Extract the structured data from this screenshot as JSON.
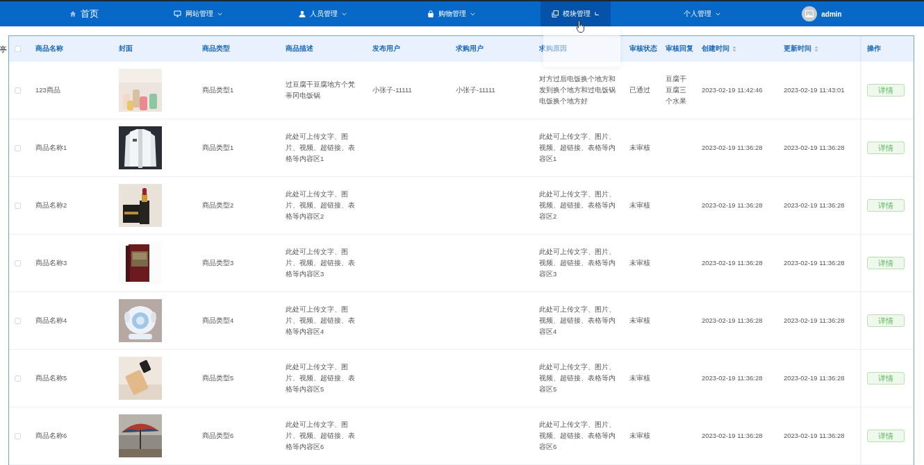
{
  "nav": {
    "items": [
      {
        "label": "首页",
        "kind": "link",
        "selected": false
      },
      {
        "label": "网站管理",
        "kind": "menu",
        "selected": false,
        "expanded": false
      },
      {
        "label": "人员管理",
        "kind": "menu",
        "selected": false,
        "expanded": false
      },
      {
        "label": "购物管理",
        "kind": "menu",
        "selected": false,
        "expanded": false
      },
      {
        "label": "模块管理",
        "kind": "menu",
        "selected": true,
        "expanded": true
      },
      {
        "label": "个人管理",
        "kind": "menu",
        "selected": false,
        "expanded": false
      }
    ],
    "user": {
      "name": "admin"
    }
  },
  "stray_text": "亭",
  "table": {
    "header_checked": false,
    "columns": [
      {
        "label": "商品名称"
      },
      {
        "label": "封面"
      },
      {
        "label": "商品类型"
      },
      {
        "label": "商品描述"
      },
      {
        "label": "发布用户"
      },
      {
        "label": "求购用户"
      },
      {
        "label": "求购原因"
      },
      {
        "label": "审核状态"
      },
      {
        "label": "审核回复"
      },
      {
        "label": "创建时间",
        "sortable": true
      },
      {
        "label": "更新时间",
        "sortable": true
      },
      {
        "label": "操作"
      }
    ],
    "rows": [
      {
        "checked": false,
        "name": "123商品",
        "type": "商品类型1",
        "description": "过豆腐干豆腐地方个梵蒂冈电饭锅",
        "publisher": "小张子-11111",
        "buyer": "小张子-11111",
        "reason": "对方过后电饭换个地方和发到换个地方和过电饭锅电饭换个地方好",
        "status": "已通过",
        "reply": "豆腐干豆腐三个水果",
        "created": "2023-02-19 11:42:46",
        "updated": "2023-02-19 11:43:01",
        "action": "详情"
      },
      {
        "checked": false,
        "name": "商品名称1",
        "type": "商品类型1",
        "description": "此处可上传文字、图片、视频、超链接、表格等内容区1",
        "reason": "此处可上传文字、图片、视频、超链接、表格等内容区1",
        "status": "未审核",
        "created": "2023-02-19 11:36:28",
        "updated": "2023-02-19 11:36:28",
        "action": "详情"
      },
      {
        "checked": false,
        "name": "商品名称2",
        "type": "商品类型2",
        "description": "此处可上传文字、图片、视频、超链接、表格等内容区2",
        "reason": "此处可上传文字、图片、视频、超链接、表格等内容区2",
        "status": "未审核",
        "created": "2023-02-19 11:36:28",
        "updated": "2023-02-19 11:36:28",
        "action": "详情"
      },
      {
        "checked": false,
        "name": "商品名称3",
        "type": "商品类型3",
        "description": "此处可上传文字、图片、视频、超链接、表格等内容区3",
        "reason": "此处可上传文字、图片、视频、超链接、表格等内容区3",
        "status": "未审核",
        "created": "2023-02-19 11:36:28",
        "updated": "2023-02-19 11:36:28",
        "action": "详情"
      },
      {
        "checked": false,
        "name": "商品名称4",
        "type": "商品类型4",
        "description": "此处可上传文字、图片、视频、超链接、表格等内容区4",
        "reason": "此处可上传文字、图片、视频、超链接、表格等内容区4",
        "status": "未审核",
        "created": "2023-02-19 11:36:28",
        "updated": "2023-02-19 11:36:28",
        "action": "详情"
      },
      {
        "checked": false,
        "name": "商品名称5",
        "type": "商品类型5",
        "description": "此处可上传文字、图片、视频、超链接、表格等内容区5",
        "reason": "此处可上传文字、图片、视频、超链接、表格等内容区5",
        "status": "未审核",
        "created": "2023-02-19 11:36:28",
        "updated": "2023-02-19 11:36:28",
        "action": "详情"
      },
      {
        "checked": false,
        "name": "商品名称6",
        "type": "商品类型6",
        "description": "此处可上传文字、图片、视频、超链接、表格等内容区6",
        "reason": "此处可上传文字、图片、视频、超链接、表格等内容区6",
        "status": "未审核",
        "created": "2023-02-19 11:36:28",
        "updated": "2023-02-19 11:36:28",
        "action": "详情"
      }
    ]
  }
}
